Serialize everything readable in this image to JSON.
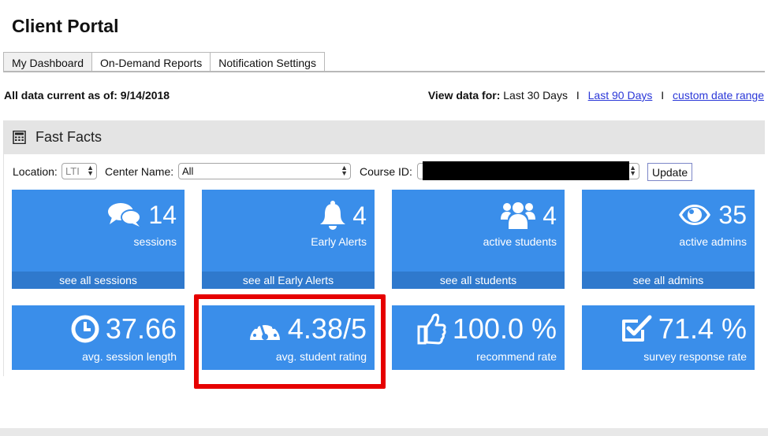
{
  "title": "Client Portal",
  "tabs": [
    {
      "label": "My Dashboard",
      "active": true
    },
    {
      "label": "On-Demand Reports",
      "active": false
    },
    {
      "label": "Notification Settings",
      "active": false
    }
  ],
  "data_current": "All data current as of: 9/14/2018",
  "view_data": {
    "label": "View data for:",
    "current": "Last 30 Days",
    "separator": "I",
    "link_90": "Last 90 Days",
    "link_custom": "custom date range"
  },
  "panel": {
    "title": "Fast Facts",
    "icon": "calculator-icon"
  },
  "filters": {
    "location_label": "Location:",
    "location_value": "LTI",
    "center_label": "Center Name:",
    "center_value": "All",
    "course_label": "Course ID:",
    "course_value": "",
    "update_label": "Update"
  },
  "tiles": [
    {
      "icon": "comments-icon",
      "value": "14",
      "label": "sessions",
      "footer": "see all sessions"
    },
    {
      "icon": "bell-icon",
      "value": "4",
      "label": "Early Alerts",
      "footer": "see all Early Alerts"
    },
    {
      "icon": "users-icon",
      "value": "4",
      "label": "active students",
      "footer": "see all students"
    },
    {
      "icon": "eye-icon",
      "value": "35",
      "label": "active admins",
      "footer": "see all admins"
    },
    {
      "icon": "clock-icon",
      "value": "37.66",
      "label": "avg. session length"
    },
    {
      "icon": "dashboard-gauge-icon",
      "value": "4.38/5",
      "label": "avg. student rating"
    },
    {
      "icon": "thumbs-up-icon",
      "value": "100.0 %",
      "label": "recommend rate"
    },
    {
      "icon": "check-square-icon",
      "value": "71.4 %",
      "label": "survey response rate"
    }
  ],
  "colors": {
    "tile_bg": "#3a8eea",
    "tile_footer": "#2f79cd",
    "highlight": "#e60000",
    "link": "#2a37d8"
  }
}
